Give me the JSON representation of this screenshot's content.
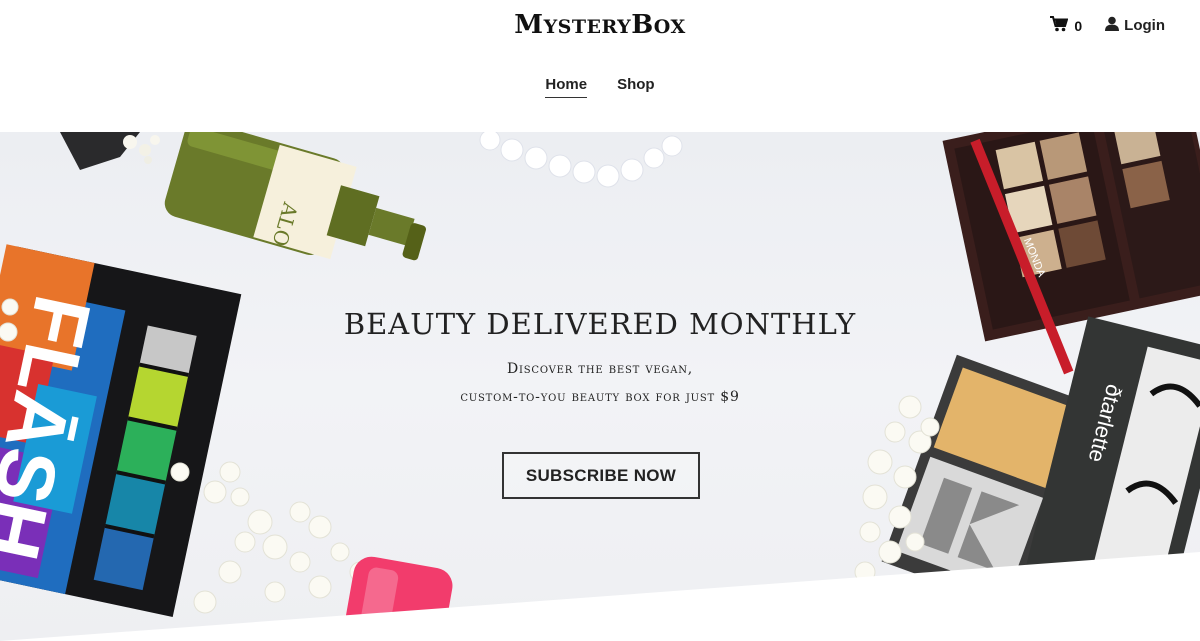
{
  "brand": {
    "logo_text": "MysteryBox"
  },
  "header": {
    "cart_count": "0",
    "login_label": "Login"
  },
  "nav": {
    "items": [
      {
        "label": "Home",
        "active": true
      },
      {
        "label": "Shop",
        "active": false
      }
    ]
  },
  "hero": {
    "title": "BEAUTY DELIVERED MONTHLY",
    "subtitle_line1": "Discover the best vegan,",
    "subtitle_line2": "custom-to-you beauty box for just $9",
    "cta_label": "SUBSCRIBE NOW",
    "product_labels": {
      "bottle": "ALO",
      "palette": "FLĀSH",
      "pencil": "MONDA",
      "lashes": "ðtarlette"
    }
  },
  "colors": {
    "accent": "#222222",
    "hero_bg": "#eef0f3"
  }
}
